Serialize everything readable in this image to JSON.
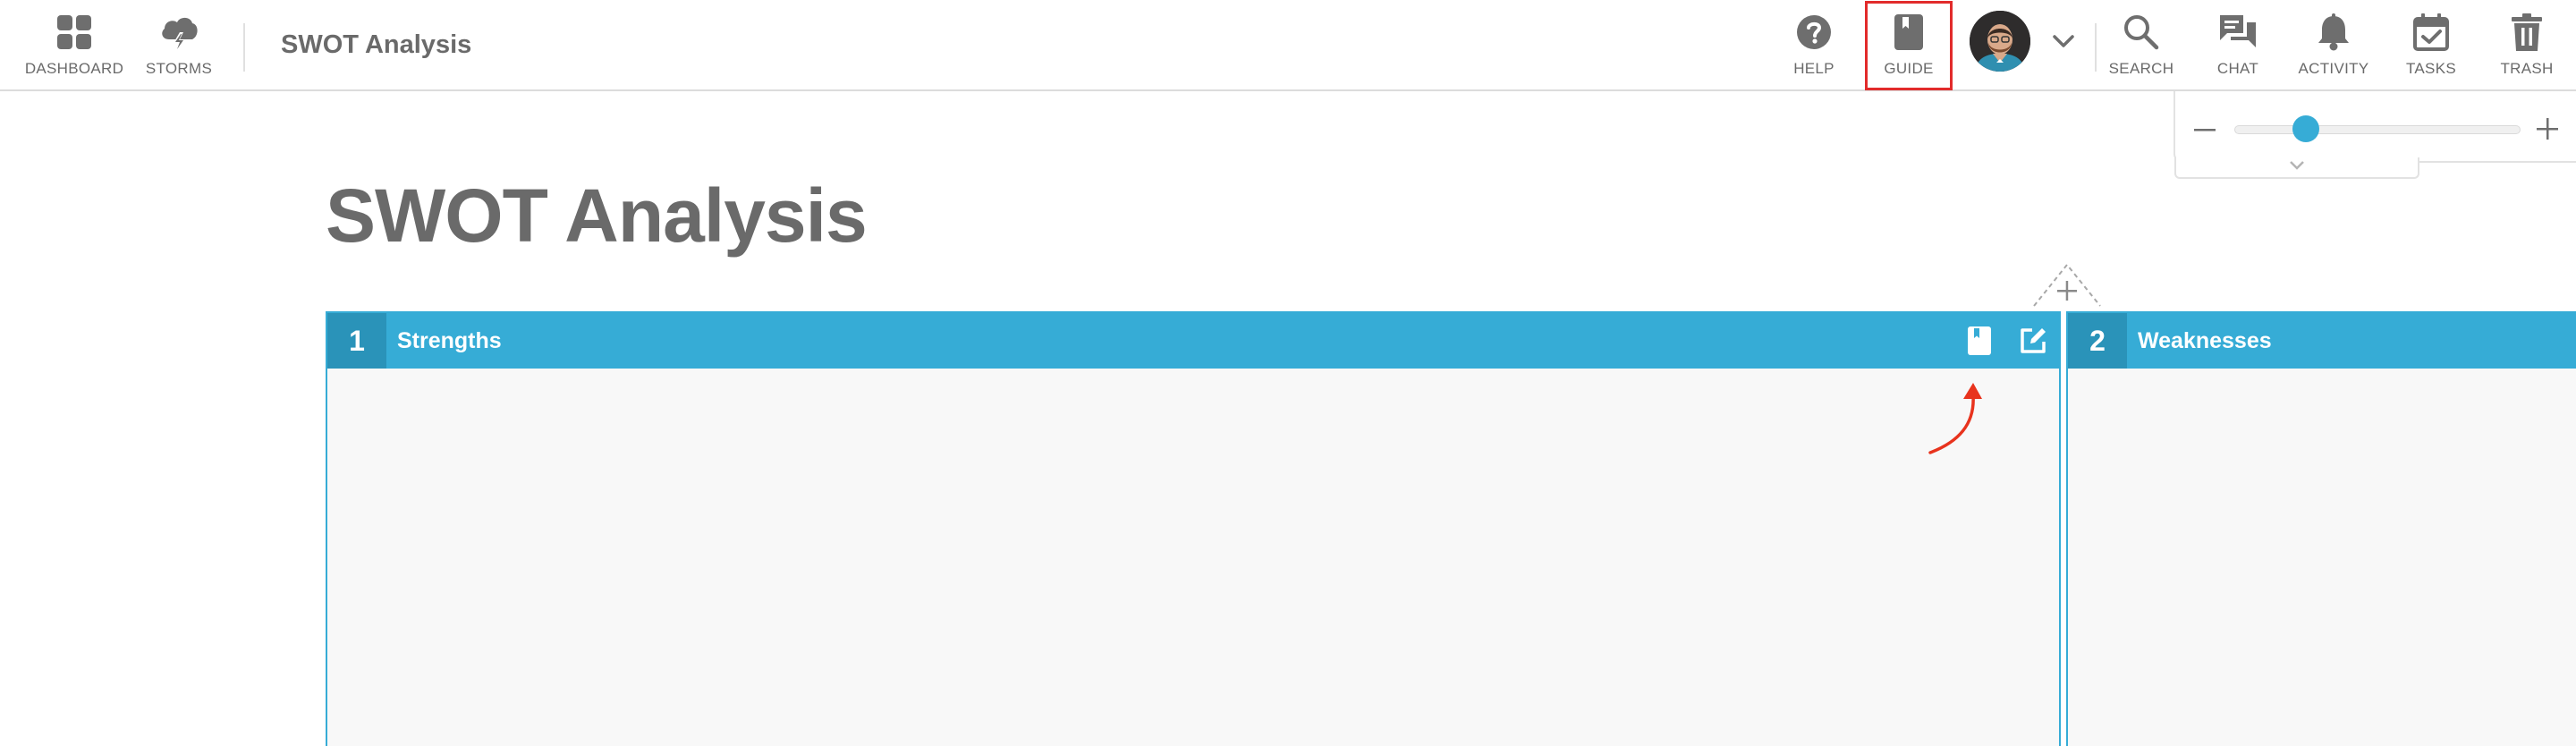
{
  "nav": {
    "dashboard_label": "DASHBOARD",
    "storms_label": "STORMS",
    "app_title": "SWOT Analysis",
    "help_label": "HELP",
    "guide_label": "GUIDE",
    "search_label": "SEARCH",
    "chat_label": "CHAT",
    "activity_label": "ACTIVITY",
    "tasks_label": "TASKS",
    "trash_label": "TRASH"
  },
  "zoom": {
    "level": 0.25
  },
  "page": {
    "heading": "SWOT Analysis"
  },
  "columns": [
    {
      "number": "1",
      "title": "Strengths"
    },
    {
      "number": "2",
      "title": "Weaknesses"
    }
  ],
  "colors": {
    "accent": "#36acd6",
    "accent_dark": "#2a93b9",
    "highlight": "#e22b2b",
    "annotation_arrow": "#e8331d",
    "text_gray": "#6a6a6a"
  },
  "icons": [
    "dashboard-icon",
    "storms-icon",
    "help-icon",
    "guide-icon",
    "search-icon",
    "chat-icon",
    "activity-icon",
    "tasks-icon",
    "trash-icon",
    "guide-icon",
    "edit-icon"
  ]
}
